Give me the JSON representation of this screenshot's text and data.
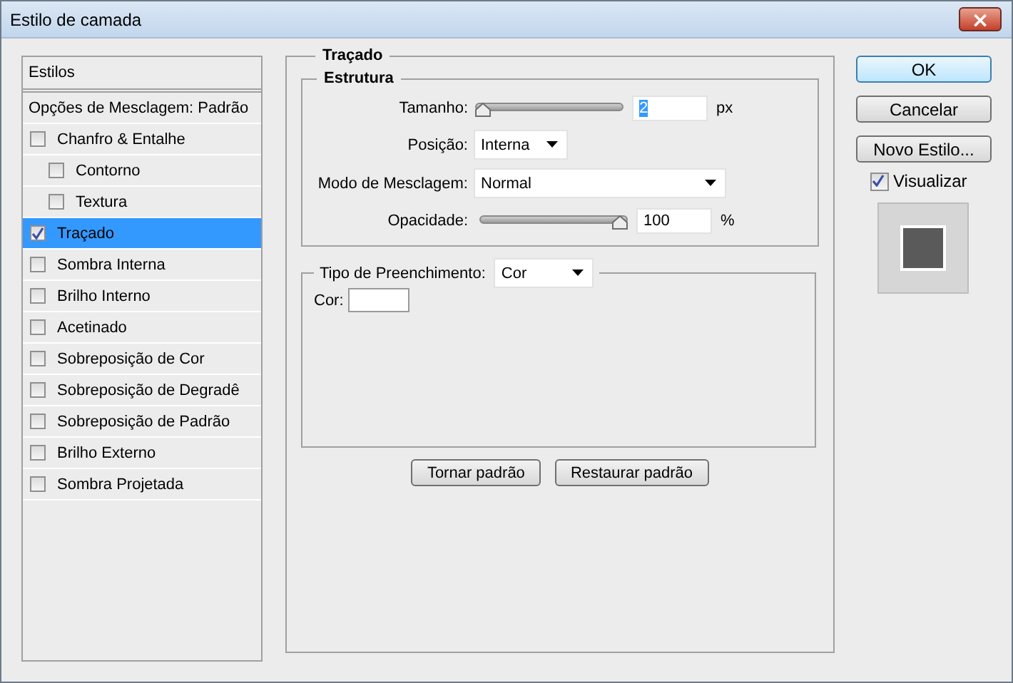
{
  "window": {
    "title": "Estilo de camada",
    "close": "×"
  },
  "styles_list": [
    {
      "kind": "header",
      "label": "Estilos",
      "selected": false
    },
    {
      "kind": "option",
      "label": "Opções de Mesclagem: Padrão",
      "selected": false
    },
    {
      "kind": "effect",
      "label": "Chanfro & Entalhe",
      "checked": false,
      "selected": false,
      "children": [
        {
          "kind": "effect",
          "label": "Contorno",
          "checked": false,
          "selected": false
        },
        {
          "kind": "effect",
          "label": "Textura",
          "checked": false,
          "selected": false
        }
      ]
    },
    {
      "kind": "effect",
      "label": "Traçado",
      "checked": true,
      "selected": true
    },
    {
      "kind": "effect",
      "label": "Sombra Interna",
      "checked": false,
      "selected": false
    },
    {
      "kind": "effect",
      "label": "Brilho Interno",
      "checked": false,
      "selected": false
    },
    {
      "kind": "effect",
      "label": "Acetinado",
      "checked": false,
      "selected": false
    },
    {
      "kind": "effect",
      "label": "Sobreposição de Cor",
      "checked": false,
      "selected": false
    },
    {
      "kind": "effect",
      "label": "Sobreposição de Degradê",
      "checked": false,
      "selected": false
    },
    {
      "kind": "effect",
      "label": "Sobreposição de Padrão",
      "checked": false,
      "selected": false
    },
    {
      "kind": "effect",
      "label": "Brilho Externo",
      "checked": false,
      "selected": false
    },
    {
      "kind": "effect",
      "label": "Sombra Projetada",
      "checked": false,
      "selected": false
    }
  ],
  "panel": {
    "title": "Traçado",
    "structure": {
      "title": "Estrutura",
      "rows": [
        {
          "kind": "slider",
          "label": "Tamanho:",
          "level": 0,
          "value": "2",
          "text_selected": true,
          "unit": "px"
        },
        {
          "kind": "dropdown",
          "label": "Posição:",
          "value": "Interna"
        },
        {
          "kind": "wide_dropdown",
          "label": "Modo de Mesclagem:",
          "value": "Normal"
        },
        {
          "kind": "slider",
          "label": "Opacidade:",
          "level": 1,
          "value": "100",
          "text_selected": false,
          "unit": "%"
        }
      ]
    },
    "fill": {
      "label": "Tipo de Preenchimento:",
      "value": "Cor",
      "color_label": "Cor:",
      "color": "#ffffff"
    },
    "buttons": [
      "Tornar padrão",
      "Restaurar padrão"
    ]
  },
  "side": {
    "buttons": [
      {
        "label": "OK",
        "default": true
      },
      {
        "label": "Cancelar",
        "default": false
      },
      {
        "label": "Novo Estilo...",
        "default": false
      }
    ],
    "preview": {
      "label": "Visualizar",
      "checked": true
    }
  }
}
